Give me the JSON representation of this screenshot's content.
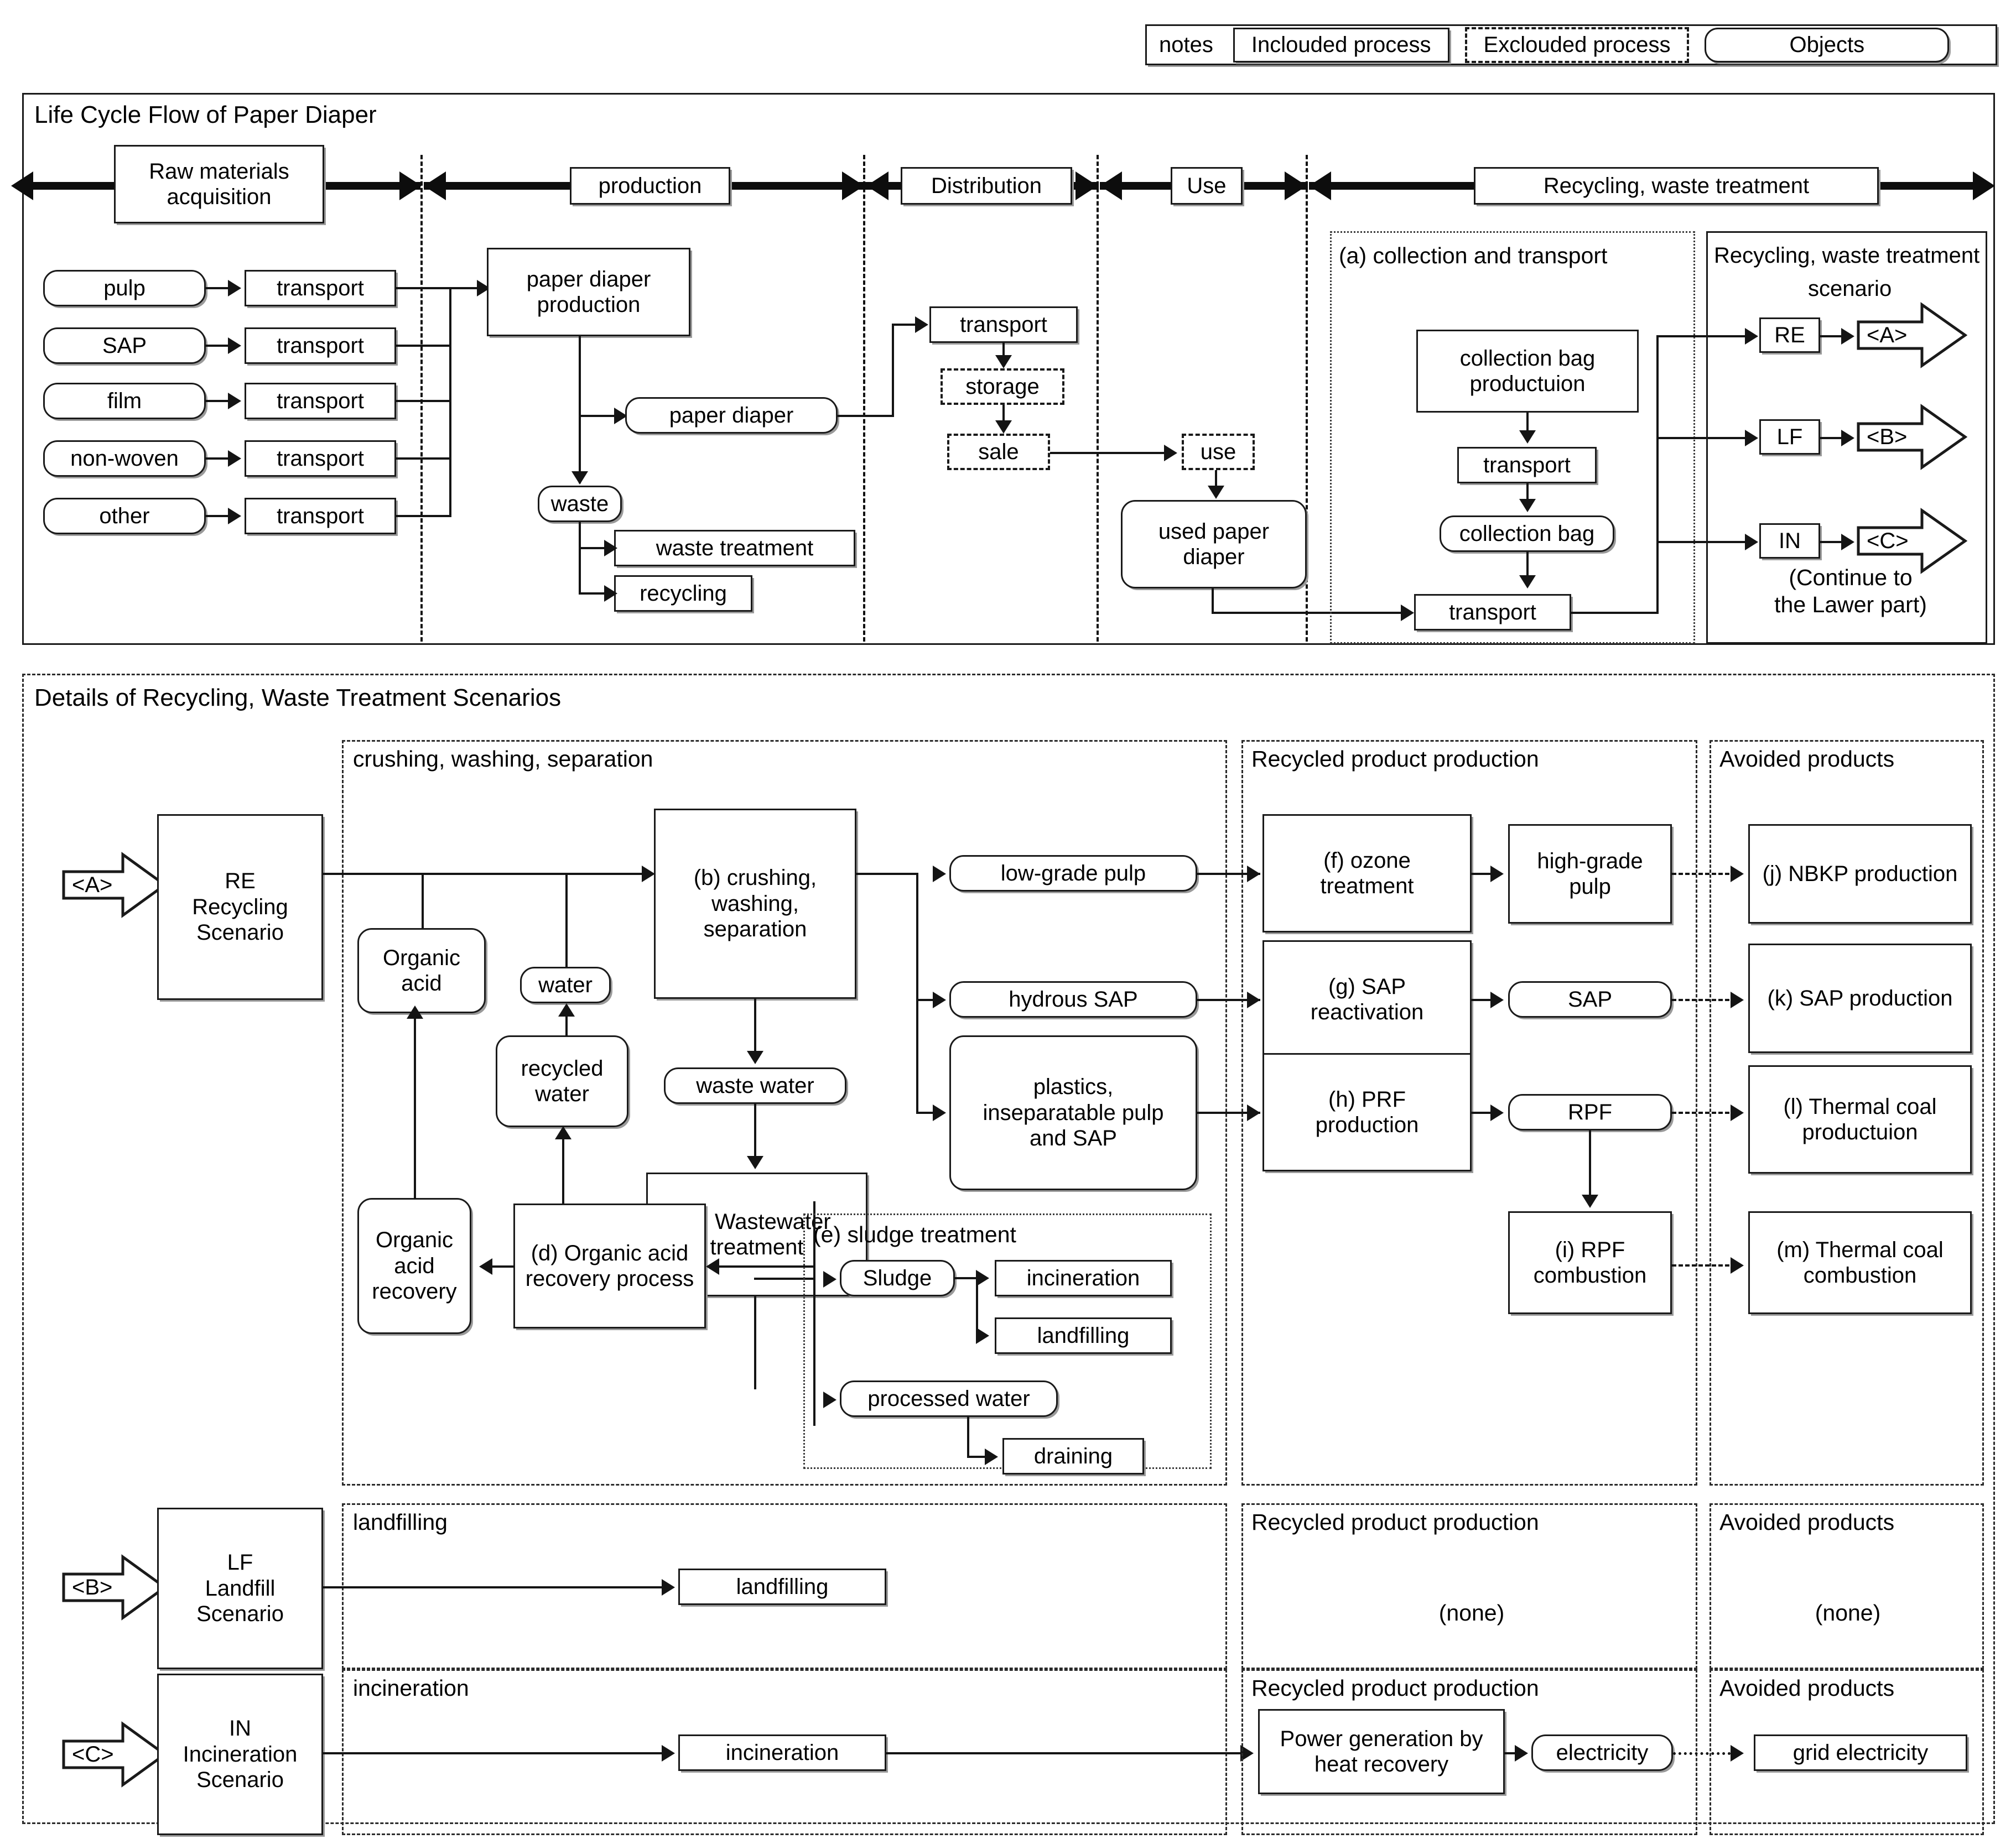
{
  "legend": {
    "notes_label": "notes",
    "included": "Inclouded process",
    "excluded": "Exclouded process",
    "objects": "Objects"
  },
  "upper": {
    "title": "Life Cycle Flow of Paper Diaper",
    "phases": [
      {
        "label": "Raw materials\nacquisition"
      },
      {
        "label": "production"
      },
      {
        "label": "Distribution"
      },
      {
        "label": "Use"
      },
      {
        "label": "Recycling, waste treatment"
      }
    ],
    "phase_raw_line1": "Raw materials",
    "phase_raw_line2": "acquisition",
    "phase_production": "production",
    "phase_distribution": "Distribution",
    "phase_use": "Use",
    "phase_recycling": "Recycling, waste treatment",
    "materials": [
      "pulp",
      "SAP",
      "film",
      "non-woven",
      "other"
    ],
    "transport_label": "transport",
    "paper_diaper_production": "paper diaper\nproduction",
    "pdp_line1": "paper diaper",
    "pdp_line2": "production",
    "paper_diaper": "paper diaper",
    "waste": "waste",
    "waste_treatment": "waste treatment",
    "recycling": "recycling",
    "dist_transport": "transport",
    "storage": "storage",
    "sale": "sale",
    "use": "use",
    "used_paper_diaper_l1": "used paper",
    "used_paper_diaper_l2": "diaper",
    "collection_frame_label": "(a) collection and transport",
    "collection_bag_production_l1": "collection bag",
    "collection_bag_production_l2": "productuion",
    "collection_transport1": "transport",
    "collection_bag": "collection bag",
    "collection_transport2": "transport",
    "scenario_frame_l1": "Recycling, waste treatment",
    "scenario_frame_l2": "scenario",
    "scenario_re": "RE",
    "scenario_lf": "LF",
    "scenario_in": "IN",
    "tag_a": "<A>",
    "tag_b": "<B>",
    "tag_c": "<C>",
    "continue_l1": "(Continue to",
    "continue_l2": "the Lawer part)"
  },
  "lower": {
    "title": "Details of Recycling, Waste Treatment Scenarios",
    "col_crushing": "crushing, washing, separation",
    "col_recycled": "Recycled product production",
    "col_avoided": "Avoided products",
    "col_landfilling": "landfilling",
    "col_incineration": "incineration",
    "tag_a": "<A>",
    "tag_b": "<B>",
    "tag_c": "<C>",
    "re_scenario_l1": "RE",
    "re_scenario_l2": "Recycling",
    "re_scenario_l3": "Scenario",
    "lf_scenario_l1": "LF",
    "lf_scenario_l2": "Landfill",
    "lf_scenario_l3": "Scenario",
    "in_scenario_l1": "IN",
    "in_scenario_l2": "Incineration",
    "in_scenario_l3": "Scenario",
    "organic_acid_l1": "Organic",
    "organic_acid_l2": "acid",
    "water": "water",
    "recycled_water_l1": "recycled",
    "recycled_water_l2": "water",
    "b_crushing_l1": "(b) crushing,",
    "b_crushing_l2": "washing,",
    "b_crushing_l3": "separation",
    "waste_water": "waste water",
    "c_wastewater_l1": "(c) Wastewater",
    "c_wastewater_l2": "treatment",
    "organic_acid_recovery_l1": "Organic",
    "organic_acid_recovery_l2": "acid",
    "organic_acid_recovery_l3": "recovery",
    "d_recovery_l1": "(d) Organic acid",
    "d_recovery_l2": "recovery process",
    "e_sludge_label": "(e) sludge treatment",
    "sludge": "Sludge",
    "incineration_box": "incineration",
    "landfilling_box": "landfilling",
    "processed_water": "processed water",
    "draining": "draining",
    "low_grade_pulp": "low-grade pulp",
    "hydrous_sap": "hydrous SAP",
    "plastics_l1": "plastics,",
    "plastics_l2": "inseparatable pulp",
    "plastics_l3": "and SAP",
    "f_ozone_l1": "(f) ozone",
    "f_ozone_l2": "treatment",
    "high_grade_pulp_l1": "high-grade",
    "high_grade_pulp_l2": "pulp",
    "g_sap_l1": "(g) SAP",
    "g_sap_l2": "reactivation",
    "sap": "SAP",
    "h_prf_l1": "(h) PRF",
    "h_prf_l2": "production",
    "rpf": "RPF",
    "i_rpf_l1": "(i) RPF",
    "i_rpf_l2": "combustion",
    "j_nbkp": "(j) NBKP production",
    "k_sap": "(k) SAP production",
    "l_thermal_l1": "(l) Thermal coal",
    "l_thermal_l2": "productuion",
    "m_thermal_l1": "(m) Thermal coal",
    "m_thermal_l2": "combustion",
    "landfilling_lf": "landfilling",
    "incineration_in": "incineration",
    "none_1": "(none)",
    "none_2": "(none)",
    "power_generation_l1": "Power generation by",
    "power_generation_l2": "heat recovery",
    "electricity": "electricity",
    "grid_electricity": "grid electricity",
    "recycled_header_lf": "Recycled product production",
    "avoided_header_lf": "Avoided products",
    "recycled_header_in": "Recycled product production",
    "avoided_header_in": "Avoided products"
  }
}
